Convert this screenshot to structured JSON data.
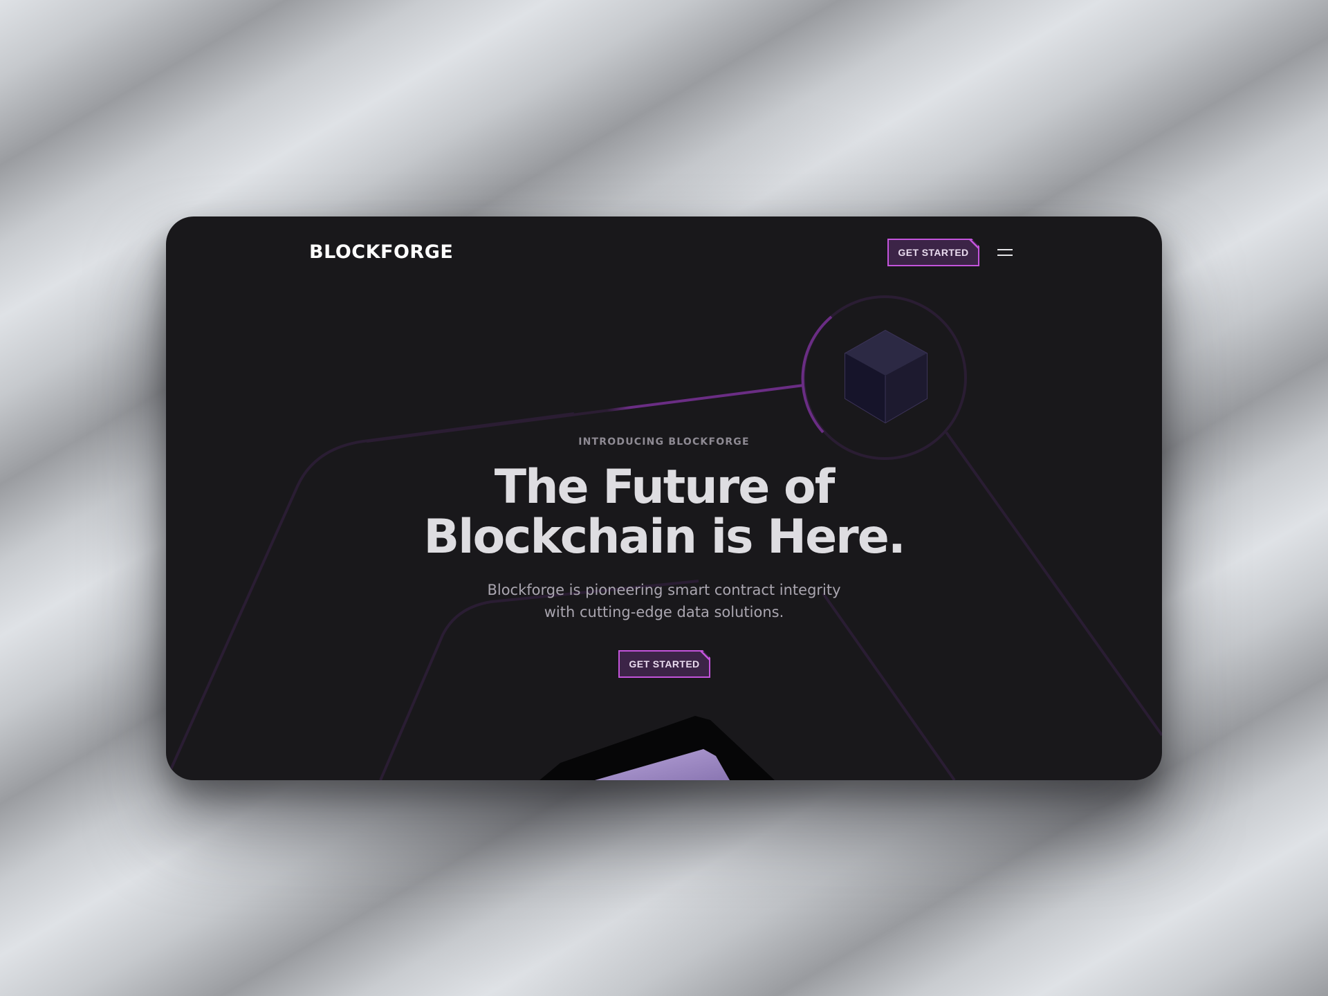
{
  "brand": {
    "name": "BLOCKFORGE"
  },
  "nav": {
    "cta_label": "GET STARTED",
    "menu_icon": "hamburger-menu-icon"
  },
  "hero": {
    "eyebrow": "INTRODUCING BLOCKFORGE",
    "title_line1": "The Future of",
    "title_line2": "Blockchain is Here.",
    "subtitle_line1": "Blockforge is pioneering smart contract integrity",
    "subtitle_line2": "with cutting-edge data solutions.",
    "cta_label": "GET STARTED"
  },
  "colors": {
    "background": "#19181b",
    "accent": "#c454dc",
    "button_fill": "#3c2447",
    "heading": "#dedde1",
    "muted_text": "#aaa6b0"
  },
  "icons": {
    "hero_cube": "cube-icon",
    "bottom_block": "block-icon"
  }
}
